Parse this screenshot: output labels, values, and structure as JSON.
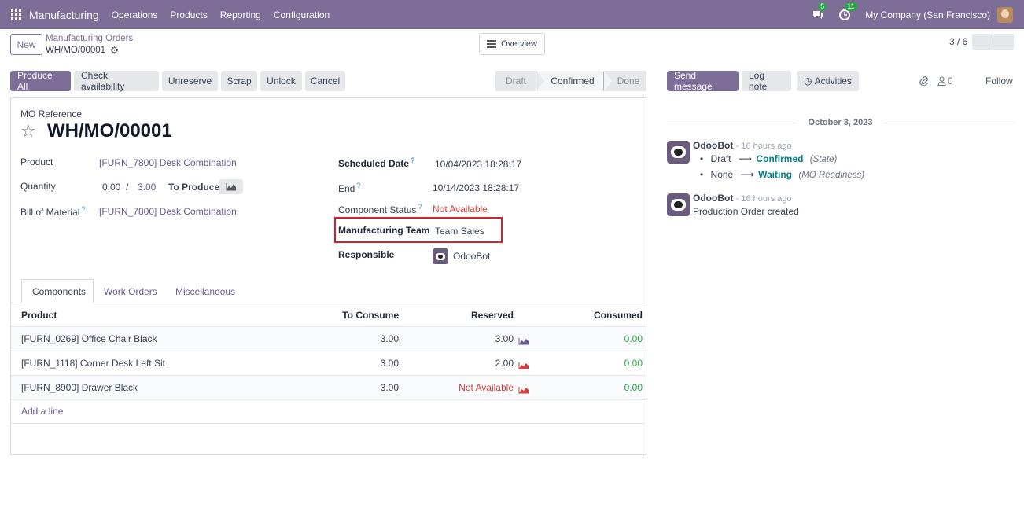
{
  "navbar": {
    "app_name": "Manufacturing",
    "menus": [
      "Operations",
      "Products",
      "Reporting",
      "Configuration"
    ],
    "messages_count": "5",
    "activities_count": "11",
    "company": "My Company (San Francisco)"
  },
  "control_panel": {
    "new_label": "New",
    "breadcrumb_parent": "Manufacturing Orders",
    "breadcrumb_current": "WH/MO/00001",
    "overview_label": "Overview",
    "pager": "3 / 6"
  },
  "actions": {
    "produce_all": "Produce All",
    "check_availability": "Check availability",
    "unreserve": "Unreserve",
    "scrap": "Scrap",
    "unlock": "Unlock",
    "cancel": "Cancel"
  },
  "statusbar": {
    "draft": "Draft",
    "confirmed": "Confirmed",
    "done": "Done"
  },
  "form": {
    "mo_reference_label": "MO Reference",
    "mo_reference": "WH/MO/00001",
    "product_label": "Product",
    "product": "[FURN_7800] Desk Combination",
    "quantity_label": "Quantity",
    "quantity_done": "0.00",
    "quantity_sep": "/",
    "quantity_total": "3.00",
    "to_produce": "To Produce",
    "bom_label": "Bill of Material",
    "bom": "[FURN_7800] Desk Combination",
    "scheduled_date_label": "Scheduled Date",
    "scheduled_date": "10/04/2023 18:28:17",
    "end_label": "End",
    "end": "10/14/2023 18:28:17",
    "component_status_label": "Component Status",
    "component_status": "Not Available",
    "team_label": "Manufacturing Team",
    "team": "Team Sales",
    "responsible_label": "Responsible",
    "responsible": "OdooBot",
    "help_mark": "?"
  },
  "tabs": [
    "Components",
    "Work Orders",
    "Miscellaneous"
  ],
  "components": {
    "headers": [
      "Product",
      "To Consume",
      "Reserved",
      "Consumed"
    ],
    "rows": [
      {
        "product": "[FURN_0269] Office Chair Black",
        "to_consume": "3.00",
        "reserved": "3.00",
        "consumed": "0.00"
      },
      {
        "product": "[FURN_1118] Corner Desk Left Sit",
        "to_consume": "3.00",
        "reserved": "2.00",
        "consumed": "0.00"
      },
      {
        "product": "[FURN_8900] Drawer Black",
        "to_consume": "3.00",
        "reserved": "Not Available",
        "consumed": "0.00"
      }
    ],
    "add_line": "Add a line"
  },
  "chatter": {
    "send_message": "Send message",
    "log_note": "Log note",
    "activities": "Activities",
    "followers_count": "0",
    "follow": "Follow",
    "date": "October 3, 2023",
    "messages": [
      {
        "author": "OdooBot",
        "time": "- 16 hours ago",
        "changes": [
          {
            "from": "Draft",
            "to": "Confirmed",
            "field": "(State)"
          },
          {
            "from": "None",
            "to": "Waiting",
            "field": "(MO Readiness)"
          }
        ]
      },
      {
        "author": "OdooBot",
        "time": "- 16 hours ago",
        "body": "Production Order created"
      }
    ]
  },
  "colors": {
    "brand": "#7c6e97",
    "danger": "#d23f3a",
    "success": "#28a745",
    "teal": "#017e84"
  }
}
